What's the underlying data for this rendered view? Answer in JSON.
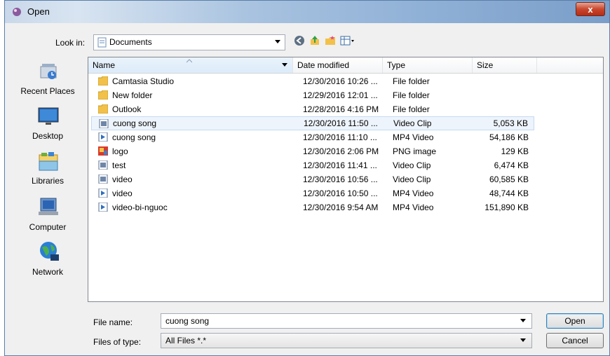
{
  "window": {
    "title": "Open",
    "close_glyph": "x"
  },
  "lookin": {
    "label": "Look in:",
    "value": "Documents"
  },
  "places": [
    {
      "label": "Recent Places",
      "icon": "recent-places-icon"
    },
    {
      "label": "Desktop",
      "icon": "desktop-icon"
    },
    {
      "label": "Libraries",
      "icon": "libraries-icon"
    },
    {
      "label": "Computer",
      "icon": "computer-icon"
    },
    {
      "label": "Network",
      "icon": "network-icon"
    }
  ],
  "columns": {
    "name": "Name",
    "date": "Date modified",
    "type": "Type",
    "size": "Size"
  },
  "files": [
    {
      "name": "Camtasia Studio",
      "date": "12/30/2016 10:26 ...",
      "type": "File folder",
      "size": "",
      "icon": "folder-icon"
    },
    {
      "name": "New folder",
      "date": "12/29/2016 12:01 ...",
      "type": "File folder",
      "size": "",
      "icon": "folder-icon"
    },
    {
      "name": "Outlook",
      "date": "12/28/2016 4:16 PM",
      "type": "File folder",
      "size": "",
      "icon": "folder-icon"
    },
    {
      "name": "cuong song",
      "date": "12/30/2016 11:50 ...",
      "type": "Video Clip",
      "size": "5,053 KB",
      "icon": "video-clip-icon",
      "selected": true
    },
    {
      "name": "cuong song",
      "date": "12/30/2016 11:10 ...",
      "type": "MP4 Video",
      "size": "54,186 KB",
      "icon": "mp4-video-icon"
    },
    {
      "name": "logo",
      "date": "12/30/2016 2:06 PM",
      "type": "PNG image",
      "size": "129 KB",
      "icon": "png-image-icon"
    },
    {
      "name": "test",
      "date": "12/30/2016 11:41 ...",
      "type": "Video Clip",
      "size": "6,474 KB",
      "icon": "video-clip-icon"
    },
    {
      "name": "video",
      "date": "12/30/2016 10:56 ...",
      "type": "Video Clip",
      "size": "60,585 KB",
      "icon": "video-clip-icon"
    },
    {
      "name": "video",
      "date": "12/30/2016 10:50 ...",
      "type": "MP4 Video",
      "size": "48,744 KB",
      "icon": "mp4-video-icon"
    },
    {
      "name": "video-bi-nguoc",
      "date": "12/30/2016 9:54 AM",
      "type": "MP4 Video",
      "size": "151,890 KB",
      "icon": "mp4-video-icon"
    }
  ],
  "filename": {
    "label": "File name:",
    "value": "cuong song"
  },
  "filetype": {
    "label": "Files of type:",
    "value": "All Files *.*"
  },
  "buttons": {
    "open": "Open",
    "cancel": "Cancel"
  }
}
